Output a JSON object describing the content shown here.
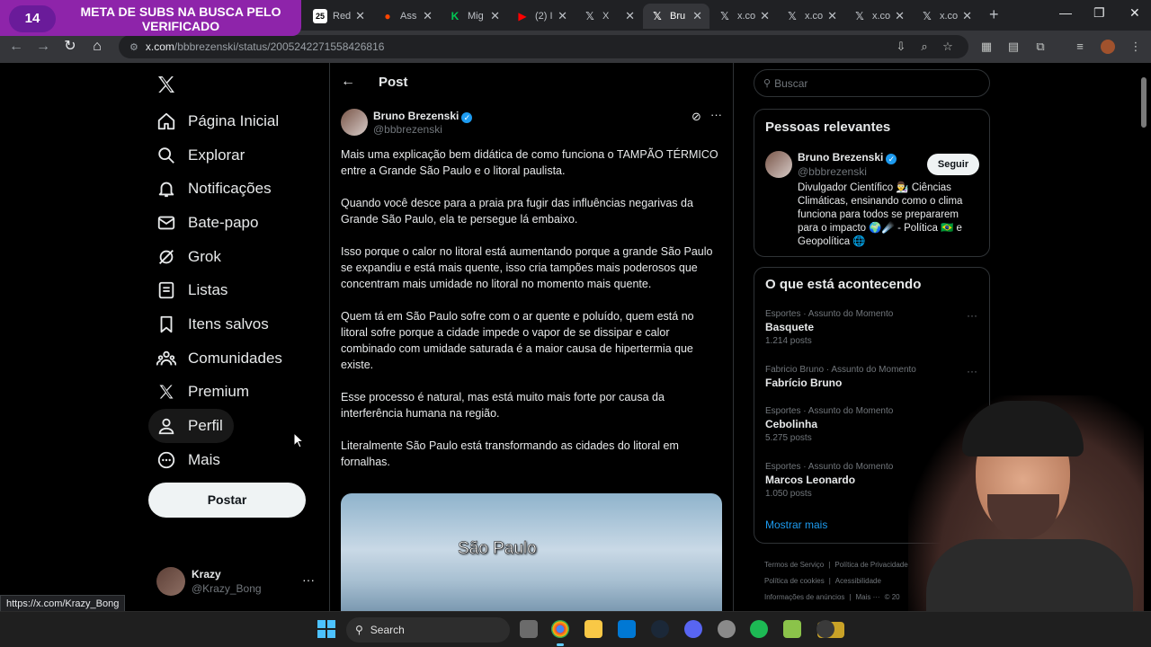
{
  "browser": {
    "overlay": {
      "count": "14",
      "title": "META DE SUBS NA BUSCA PELO VERIFICADO"
    },
    "tabs": [
      {
        "label": "Red",
        "icon": "25"
      },
      {
        "label": "Ass",
        "icon": "●"
      },
      {
        "label": "Mig",
        "icon": "K"
      },
      {
        "label": "(2) I",
        "icon": "▶"
      },
      {
        "label": "X",
        "icon": "𝕏"
      },
      {
        "label": "Bru",
        "icon": "𝕏"
      },
      {
        "label": "x.co",
        "icon": "𝕏"
      },
      {
        "label": "x.co",
        "icon": "𝕏"
      },
      {
        "label": "x.co",
        "icon": "𝕏"
      },
      {
        "label": "x.co",
        "icon": "𝕏"
      }
    ],
    "url_domain": "x.com",
    "url_path": "/bbbrezenski/status/2005242271558426816",
    "status_link": "https://x.com/Krazy_Bong"
  },
  "nav": {
    "items": [
      {
        "label": "Página Inicial"
      },
      {
        "label": "Explorar"
      },
      {
        "label": "Notificações"
      },
      {
        "label": "Bate-papo"
      },
      {
        "label": "Grok"
      },
      {
        "label": "Listas"
      },
      {
        "label": "Itens salvos"
      },
      {
        "label": "Comunidades"
      },
      {
        "label": "Premium"
      },
      {
        "label": "Perfil"
      },
      {
        "label": "Mais"
      }
    ],
    "post_button": "Postar",
    "user": {
      "name": "Krazy",
      "handle": "@Krazy_Bong"
    }
  },
  "main": {
    "title": "Post",
    "author": {
      "name": "Bruno Brezenski",
      "handle": "@bbbrezenski"
    },
    "paragraphs": [
      "Mais uma explicação bem didática de como funciona o TAMPÃO TÉRMICO entre a Grande São Paulo e o litoral paulista.",
      "Quando você desce para a praia pra fugir das influências negarivas da Grande São Paulo, ela te persegue lá embaixo.",
      "Isso porque o calor no litoral está aumentando porque a grande São Paulo se expandiu e está mais quente, isso cria tampões mais poderosos que concentram mais umidade no litoral no momento mais quente.",
      "Quem tá em São Paulo sofre com o ar quente e poluído, quem está no litoral sofre porque a cidade impede o vapor de se dissipar e calor combinado com umidade saturada é a maior causa de hipertermia que existe.",
      "Esse processo é natural, mas está muito mais forte por causa da interferência humana na região.",
      "Literalmente São Paulo está transformando as cidades do litoral em fornalhas."
    ],
    "media_caption": "São Paulo"
  },
  "sidebar": {
    "search_placeholder": "Buscar",
    "relevant": {
      "title": "Pessoas relevantes",
      "name": "Bruno Brezenski",
      "handle": "@bbbrezenski",
      "follow": "Seguir",
      "bio": "Divulgador Científico 👨‍🔬 Ciências Climáticas, ensinando como o clima funciona para todos se prepararem para o impacto 🌍☄️ - Política 🇧🇷 e Geopolítica 🌐"
    },
    "happening": {
      "title": "O que está acontecendo",
      "trends": [
        {
          "meta": "Esportes · Assunto do Momento",
          "name": "Basquete",
          "count": "1.214 posts"
        },
        {
          "meta": "Fabricio Bruno · Assunto do Momento",
          "name": "Fabrício Bruno",
          "count": ""
        },
        {
          "meta": "Esportes · Assunto do Momento",
          "name": "Cebolinha",
          "count": "5.275 posts"
        },
        {
          "meta": "Esportes · Assunto do Momento",
          "name": "Marcos Leonardo",
          "count": "1.050 posts"
        }
      ],
      "show_more": "Mostrar mais"
    },
    "footer": [
      "Termos de Serviço",
      "|",
      "Política de Privacidade",
      "|",
      "Política de cookies",
      "|",
      "Acessibilidade",
      "|",
      "Informações de anúncios",
      "|",
      "Mais ···",
      "© 20"
    ]
  },
  "taskbar": {
    "search": "Search"
  },
  "colors": {
    "accent": "#1d9bf0",
    "overlay": "#8e24aa"
  }
}
